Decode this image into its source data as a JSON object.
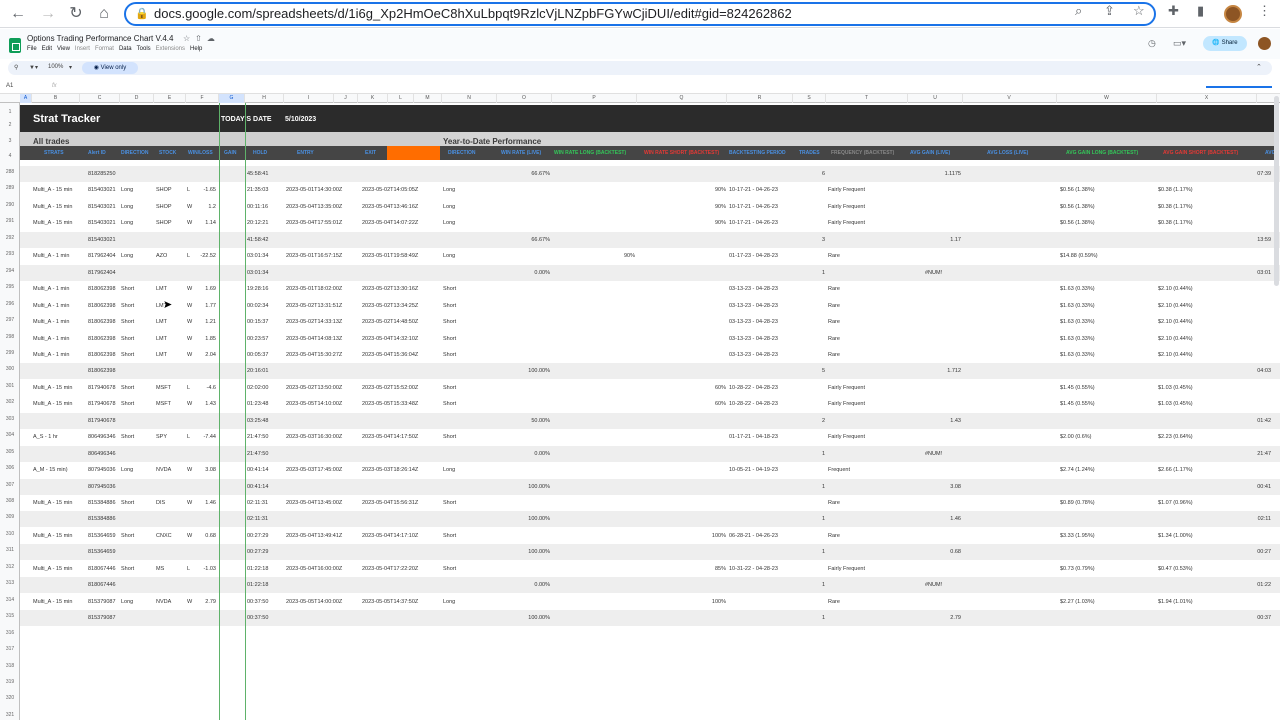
{
  "browser": {
    "url": "docs.google.com/spreadsheets/d/1i6g_Xp2HmOeC8hXuLbpqt9RzlcVjLNZpbFGYwCjiDUI/edit#gid=824262862"
  },
  "app": {
    "doc_title": "Options Trading Performance Chart V.4.4",
    "menu": [
      "File",
      "Edit",
      "View",
      "Insert",
      "Format",
      "Data",
      "Tools",
      "Extensions",
      "Help"
    ],
    "share_label": "Share",
    "zoom": "100%",
    "view_only": "View only",
    "name_box": "A1",
    "fx": "fx"
  },
  "columns": [
    "A",
    "B",
    "C",
    "D",
    "E",
    "F",
    "G",
    "H",
    "I",
    "J",
    "K",
    "L",
    "M",
    "N",
    "O",
    "P",
    "Q",
    "R",
    "S",
    "T",
    "U",
    "V",
    "W",
    "X"
  ],
  "rows_top": [
    "1",
    "2",
    "3",
    "4"
  ],
  "rows_visible": [
    "288",
    "289",
    "290",
    "291",
    "292",
    "293",
    "294",
    "295",
    "296",
    "297",
    "298",
    "299",
    "300",
    "301",
    "302",
    "303",
    "304",
    "305",
    "306",
    "307",
    "308",
    "309",
    "310",
    "311",
    "312",
    "313",
    "314",
    "315",
    "316",
    "317",
    "318",
    "319",
    "320",
    "321"
  ],
  "sheet": {
    "title": "Strat Tracker",
    "today_label": "TODAY'S DATE",
    "today_value": "5/10/2023",
    "section_left": "All trades",
    "section_right": "Year-to-Date Performance",
    "headers_left": [
      "STRATS",
      "Alert ID",
      "DIRECTION",
      "STOCK",
      "WIN/LOSS",
      "GAIN",
      "HOLD",
      "ENTRY",
      "EXIT"
    ],
    "headers_right": [
      {
        "label": "DIRECTION",
        "color": "blue"
      },
      {
        "label": "WIN RATE (LIVE)",
        "color": "blue"
      },
      {
        "label": "WIN RATE LONG (BACKTEST)",
        "color": "green"
      },
      {
        "label": "WIN RATE SHORT (BACKTEST)",
        "color": "red"
      },
      {
        "label": "BACKTESTING PERIOD",
        "color": "blue"
      },
      {
        "label": "TRADES",
        "color": "blue"
      },
      {
        "label": "FREQUENCY (BACKTEST)",
        "color": "gray"
      },
      {
        "label": "AVG GAIN (LIVE)",
        "color": "blue"
      },
      {
        "label": "AVG LOSS (LIVE)",
        "color": "blue"
      },
      {
        "label": "AVG GAIN LONG (BACKTEST)",
        "color": "green"
      },
      {
        "label": "AVG GAIN SHORT (BACKTEST)",
        "color": "red"
      },
      {
        "label": "AVG",
        "color": "blue"
      }
    ]
  },
  "trade_rows": [
    {
      "sum": true,
      "alert": "818285250",
      "hold": "45:58:41",
      "winlive": "66.67%",
      "trades": "6",
      "avggain": "1.1175",
      "last": "07:39"
    },
    {
      "strat": "Multi_A - 15 min",
      "alert": "815403021",
      "dir": "Long",
      "stock": "SHOP",
      "wl": "L",
      "gain": "-1.65",
      "hold": "21:35:03",
      "entry": "2023-05-01T14:30:00Z",
      "exit": "2023-05-02T14:05:05Z",
      "ndir": "Long",
      "wrs": "90%",
      "period": "10-17-21 - 04-26-23",
      "freq": "Fairly Frequent",
      "agl": "$0.56 (1.38%)",
      "ags": "$0.38 (1.17%)"
    },
    {
      "strat": "Multi_A - 15 min",
      "alert": "815403021",
      "dir": "Long",
      "stock": "SHOP",
      "wl": "W",
      "gain": "1.2",
      "hold": "00:11:16",
      "entry": "2023-05-04T13:35:00Z",
      "exit": "2023-05-04T13:46:16Z",
      "ndir": "Long",
      "wrs": "90%",
      "period": "10-17-21 - 04-26-23",
      "freq": "Fairly Frequent",
      "agl": "$0.56 (1.38%)",
      "ags": "$0.38 (1.17%)"
    },
    {
      "strat": "Multi_A - 15 min",
      "alert": "815403021",
      "dir": "Long",
      "stock": "SHOP",
      "wl": "W",
      "gain": "1.14",
      "hold": "20:12:21",
      "entry": "2023-05-04T17:55:01Z",
      "exit": "2023-05-04T14:07:22Z",
      "ndir": "Long",
      "wrs": "90%",
      "period": "10-17-21 - 04-26-23",
      "freq": "Fairly Frequent",
      "agl": "$0.56 (1.38%)",
      "ags": "$0.38 (1.17%)"
    },
    {
      "sum": true,
      "alert": "815403021",
      "hold": "41:58:42",
      "winlive": "66.67%",
      "trades": "3",
      "avggain": "1.17",
      "last": "13:59"
    },
    {
      "strat": "Multi_A - 1 min",
      "alert": "817962404",
      "dir": "Long",
      "stock": "AZO",
      "wl": "L",
      "gain": "-22.52",
      "hold": "03:01:34",
      "entry": "2023-05-01T16:57:15Z",
      "exit": "2023-05-01T19:58:49Z",
      "ndir": "Long",
      "wrl": "90%",
      "period": "01-17-23 - 04-28-23",
      "freq": "Rare",
      "agl": "$14.88 (0.59%)"
    },
    {
      "sum": true,
      "alert": "817962404",
      "hold": "03:01:34",
      "winlive": "0.00%",
      "trades": "1",
      "avgloss": "#NUM!",
      "last": "03:01"
    },
    {
      "strat": "Multi_A - 1 min",
      "alert": "818062398",
      "dir": "Short",
      "stock": "LMT",
      "wl": "W",
      "gain": "1.69",
      "hold": "19:28:16",
      "entry": "2023-05-01T18:02:00Z",
      "exit": "2023-05-02T13:30:16Z",
      "ndir": "Short",
      "period": "03-13-23 - 04-28-23",
      "freq": "Rare",
      "agl": "$1.63 (0.33%)",
      "ags": "$2.10 (0.44%)"
    },
    {
      "strat": "Multi_A - 1 min",
      "alert": "818062398",
      "dir": "Short",
      "stock": "LMT",
      "wl": "W",
      "gain": "1.77",
      "hold": "00:02:34",
      "entry": "2023-05-02T13:31:51Z",
      "exit": "2023-05-02T13:34:25Z",
      "ndir": "Short",
      "period": "03-13-23 - 04-28-23",
      "freq": "Rare",
      "agl": "$1.63 (0.33%)",
      "ags": "$2.10 (0.44%)"
    },
    {
      "strat": "Multi_A - 1 min",
      "alert": "818062398",
      "dir": "Short",
      "stock": "LMT",
      "wl": "W",
      "gain": "1.21",
      "hold": "00:15:37",
      "entry": "2023-05-02T14:33:13Z",
      "exit": "2023-05-02T14:48:50Z",
      "ndir": "Short",
      "period": "03-13-23 - 04-28-23",
      "freq": "Rare",
      "agl": "$1.63 (0.33%)",
      "ags": "$2.10 (0.44%)"
    },
    {
      "strat": "Multi_A - 1 min",
      "alert": "818062398",
      "dir": "Short",
      "stock": "LMT",
      "wl": "W",
      "gain": "1.85",
      "hold": "00:23:57",
      "entry": "2023-05-04T14:08:13Z",
      "exit": "2023-05-04T14:32:10Z",
      "ndir": "Short",
      "period": "03-13-23 - 04-28-23",
      "freq": "Rare",
      "agl": "$1.63 (0.33%)",
      "ags": "$2.10 (0.44%)"
    },
    {
      "strat": "Multi_A - 1 min",
      "alert": "818062398",
      "dir": "Short",
      "stock": "LMT",
      "wl": "W",
      "gain": "2.04",
      "hold": "00:05:37",
      "entry": "2023-05-04T15:30:27Z",
      "exit": "2023-05-04T15:36:04Z",
      "ndir": "Short",
      "period": "03-13-23 - 04-28-23",
      "freq": "Rare",
      "agl": "$1.63 (0.33%)",
      "ags": "$2.10 (0.44%)"
    },
    {
      "sum": true,
      "alert": "818062398",
      "hold": "20:16:01",
      "winlive": "100.00%",
      "trades": "5",
      "avggain": "1.712",
      "last": "04:03"
    },
    {
      "strat": "Multi_A - 15 min",
      "alert": "817940678",
      "dir": "Short",
      "stock": "MSFT",
      "wl": "L",
      "gain": "-4.6",
      "hold": "02:02:00",
      "entry": "2023-05-02T13:50:00Z",
      "exit": "2023-05-02T15:52:00Z",
      "ndir": "Short",
      "wrs": "60%",
      "period": "10-28-22 - 04-28-23",
      "freq": "Fairly Frequent",
      "agl": "$1.45 (0.55%)",
      "ags": "$1.03 (0.45%)"
    },
    {
      "strat": "Multi_A - 15 min",
      "alert": "817940678",
      "dir": "Short",
      "stock": "MSFT",
      "wl": "W",
      "gain": "1.43",
      "hold": "01:23:48",
      "entry": "2023-05-05T14:10:00Z",
      "exit": "2023-05-05T15:33:48Z",
      "ndir": "Short",
      "wrs": "60%",
      "period": "10-28-22 - 04-28-23",
      "freq": "Fairly Frequent",
      "agl": "$1.45 (0.55%)",
      "ags": "$1.03 (0.45%)"
    },
    {
      "sum": true,
      "alert": "817940678",
      "hold": "03:25:48",
      "winlive": "50.00%",
      "trades": "2",
      "avggain": "1.43",
      "last": "01:42"
    },
    {
      "strat": "A_S - 1 hr",
      "alert": "806496346",
      "dir": "Short",
      "stock": "SPY",
      "wl": "L",
      "gain": "-7.44",
      "hold": "21:47:50",
      "entry": "2023-05-03T16:30:00Z",
      "exit": "2023-05-04T14:17:50Z",
      "ndir": "Short",
      "period": "01-17-21 - 04-18-23",
      "freq": "Fairly Frequent",
      "agl": "$2.00 (0.6%)",
      "ags": "$2.23 (0.64%)"
    },
    {
      "sum": true,
      "alert": "806496346",
      "hold": "21:47:50",
      "winlive": "0.00%",
      "trades": "1",
      "avgloss": "#NUM!",
      "last": "21:47"
    },
    {
      "strat": "A_M - 15 min)",
      "alert": "807945036",
      "dir": "Long",
      "stock": "NVDA",
      "wl": "W",
      "gain": "3.08",
      "hold": "00:41:14",
      "entry": "2023-05-03T17:45:00Z",
      "exit": "2023-05-03T18:26:14Z",
      "ndir": "Long",
      "period": "10-05-21 - 04-19-23",
      "freq": "Frequent",
      "agl": "$2.74 (1.24%)",
      "ags": "$2.66 (1.17%)"
    },
    {
      "sum": true,
      "alert": "807945036",
      "hold": "00:41:14",
      "winlive": "100.00%",
      "trades": "1",
      "avggain": "3.08",
      "last": "00:41"
    },
    {
      "strat": "Multi_A - 15 min",
      "alert": "815384886",
      "dir": "Short",
      "stock": "DIS",
      "wl": "W",
      "gain": "1.46",
      "hold": "02:11:31",
      "entry": "2023-05-04T13:45:00Z",
      "exit": "2023-05-04T15:56:31Z",
      "ndir": "Short",
      "freq": "Rare",
      "agl": "$0.89 (0.78%)",
      "ags": "$1.07 (0.96%)"
    },
    {
      "sum": true,
      "alert": "815384886",
      "hold": "02:11:31",
      "winlive": "100.00%",
      "trades": "1",
      "avggain": "1.46",
      "last": "02:11"
    },
    {
      "strat": "Multi_A - 15 min",
      "alert": "815364659",
      "dir": "Short",
      "stock": "CNXC",
      "wl": "W",
      "gain": "0.68",
      "hold": "00:27:29",
      "entry": "2023-05-04T13:49:41Z",
      "exit": "2023-05-04T14:17:10Z",
      "ndir": "Short",
      "wrs": "100%",
      "period": "06-28-21 - 04-26-23",
      "freq": "Rare",
      "agl": "$3.33 (1.95%)",
      "ags": "$1.34 (1.00%)"
    },
    {
      "sum": true,
      "alert": "815364659",
      "hold": "00:27:29",
      "winlive": "100.00%",
      "trades": "1",
      "avggain": "0.68",
      "last": "00:27"
    },
    {
      "strat": "Multi_A - 15 min",
      "alert": "818067446",
      "dir": "Short",
      "stock": "MS",
      "wl": "L",
      "gain": "-1.03",
      "hold": "01:22:18",
      "entry": "2023-05-04T16:00:00Z",
      "exit": "2023-05-04T17:22:20Z",
      "ndir": "Short",
      "wrs": "85%",
      "period": "10-31-22 - 04-28-23",
      "freq": "Fairly Frequent",
      "agl": "$0.73 (0.79%)",
      "ags": "$0.47 (0.53%)"
    },
    {
      "sum": true,
      "alert": "818067446",
      "hold": "01:22:18",
      "winlive": "0.00%",
      "trades": "1",
      "avgloss": "#NUM!",
      "last": "01:22"
    },
    {
      "strat": "Multi_A - 15 min",
      "alert": "815379087",
      "dir": "Long",
      "stock": "NVDA",
      "wl": "W",
      "gain": "2.79",
      "hold": "00:37:50",
      "entry": "2023-05-05T14:00:00Z",
      "exit": "2023-05-05T14:37:50Z",
      "ndir": "Long",
      "wrs2": "100%",
      "freq": "Rare",
      "agl": "$2.27 (1.03%)",
      "ags": "$1.94 (1.01%)"
    },
    {
      "sum": true,
      "alert": "815379087",
      "hold": "00:37:50",
      "winlive": "100.00%",
      "trades": "1",
      "avggain": "2.79",
      "last": "00:37"
    }
  ]
}
